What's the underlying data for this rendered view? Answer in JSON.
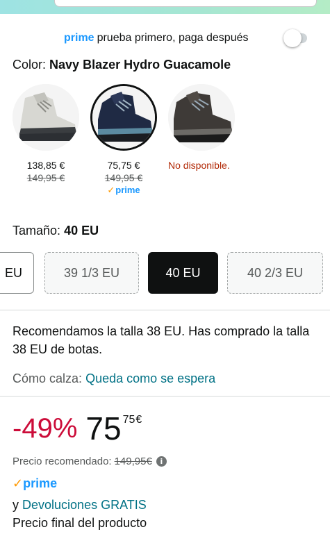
{
  "prime_trial": {
    "prime_word": "prime",
    "text": "prueba primero, paga después",
    "toggle_on": false
  },
  "color": {
    "label": "Color:",
    "value": "Navy Blazer Hydro Guacamole",
    "options": [
      {
        "name": "light-grey-boot",
        "price": "138,85 €",
        "old_price": "149,95 €",
        "prime": "",
        "unavailable": ""
      },
      {
        "name": "navy-boot",
        "price": "75,75 €",
        "old_price": "149,95 €",
        "prime": "prime",
        "unavailable": ""
      },
      {
        "name": "dark-brown-boot",
        "price": "",
        "old_price": "",
        "prime": "",
        "unavailable": "No disponible."
      }
    ]
  },
  "size": {
    "label": "Tamaño:",
    "value": "40 EU",
    "options": [
      {
        "label": "EU",
        "state": "available"
      },
      {
        "label": "39 1/3 EU",
        "state": "unavailable"
      },
      {
        "label": "40 EU",
        "state": "selected"
      },
      {
        "label": "40 2/3 EU",
        "state": "unavailable"
      }
    ]
  },
  "recommendation": "Recomendamos la talla 38 EU. Has comprado la talla 38 EU de botas.",
  "fit": {
    "label": "Cómo calza:",
    "value": "Queda como se espera"
  },
  "price": {
    "discount": "-49%",
    "whole": "75",
    "fraction": "75",
    "currency": "€",
    "recommended_label": "Precio recomendado:",
    "recommended_value": "149,95€"
  },
  "prime_badge": "prime",
  "returns": {
    "prefix": "y",
    "link": "Devoluciones GRATIS"
  },
  "final_price_text": "Precio final del producto",
  "colors": {
    "prime_blue": "#1a98ff",
    "link_teal": "#007185",
    "discount_red": "#cc0c39",
    "unavailable_red": "#b12704",
    "check_orange": "#ff9900"
  }
}
